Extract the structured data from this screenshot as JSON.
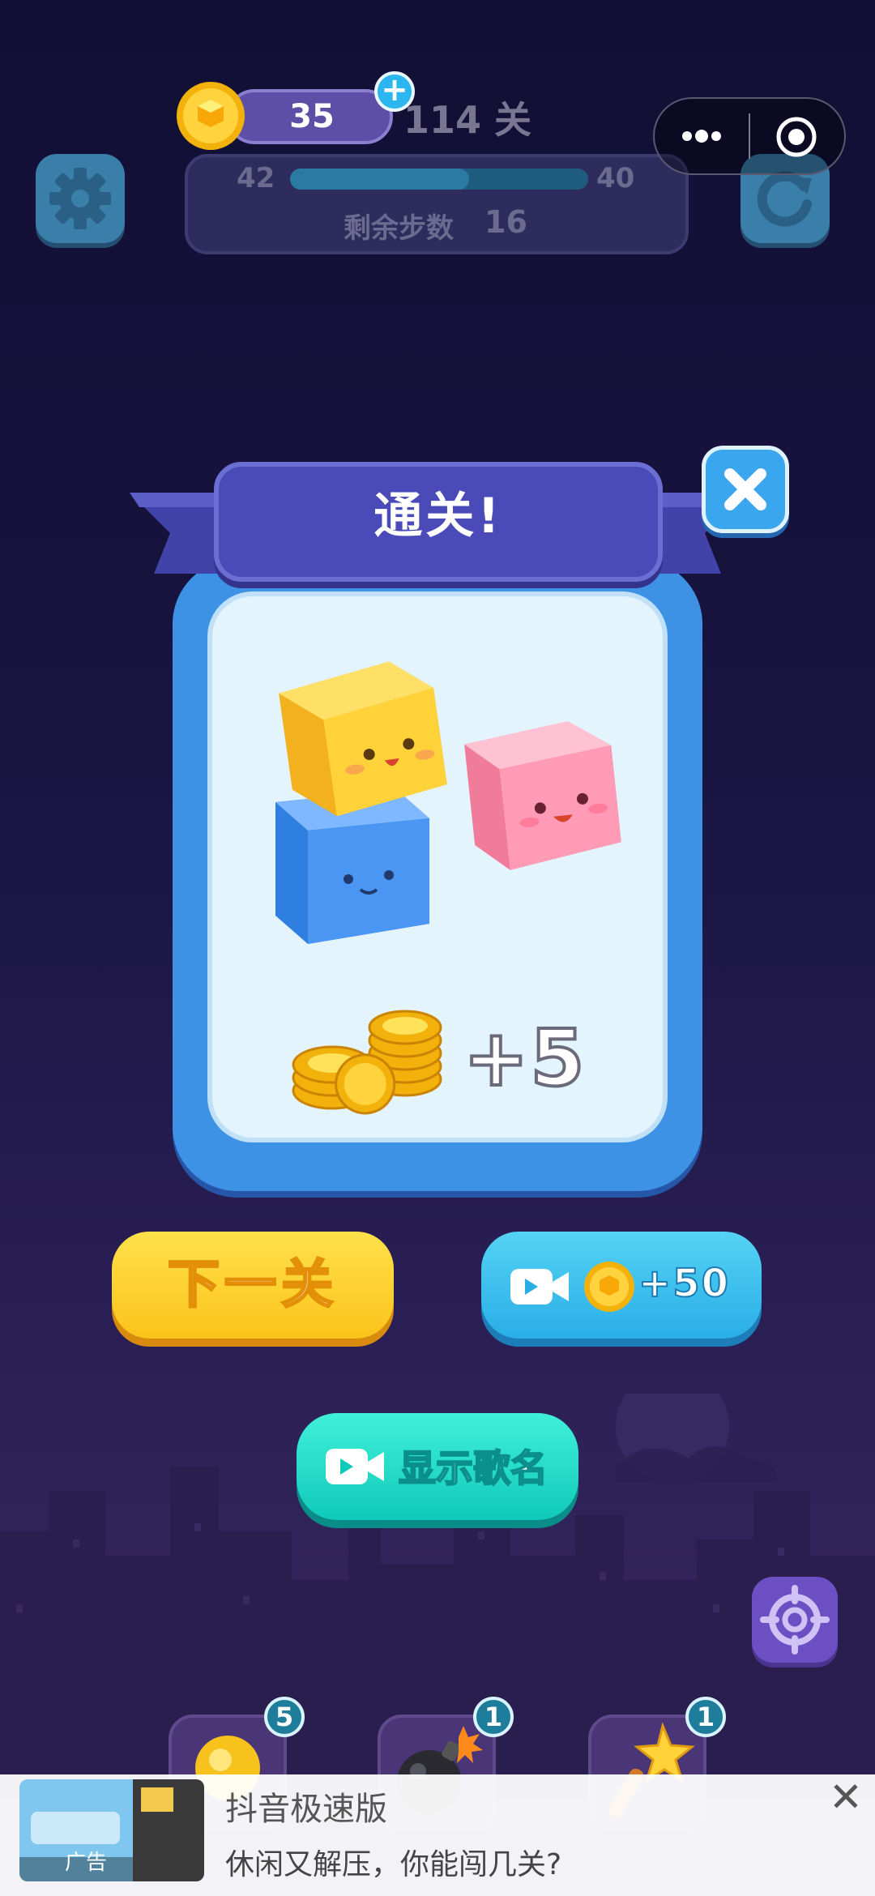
{
  "hud": {
    "coins": "35",
    "add_coins": "+",
    "level": "114 关",
    "progress_left": "42",
    "progress_right": "40",
    "progress_fraction": 0.6,
    "steps_label": "剩余步数",
    "steps_value": "16"
  },
  "dialog": {
    "title": "通关!",
    "reward": "+5"
  },
  "buttons": {
    "next_level": "下一关",
    "video_reward": "+50",
    "show_song": "显示歌名"
  },
  "powerups": [
    {
      "name": "lightbulb",
      "count": "5"
    },
    {
      "name": "bomb",
      "count": "1"
    },
    {
      "name": "magic-wand",
      "count": "1"
    }
  ],
  "ad": {
    "title": "抖音极速版",
    "subtitle": "休闲又解压，你能闯几关?",
    "tag": "广告",
    "close": "✕"
  },
  "colors": {
    "background": "#181440",
    "accent_blue": "#3e92e6",
    "ribbon": "#4a4bb8",
    "next_yellow": "#fbc31b",
    "song_teal": "#10c9b9"
  }
}
